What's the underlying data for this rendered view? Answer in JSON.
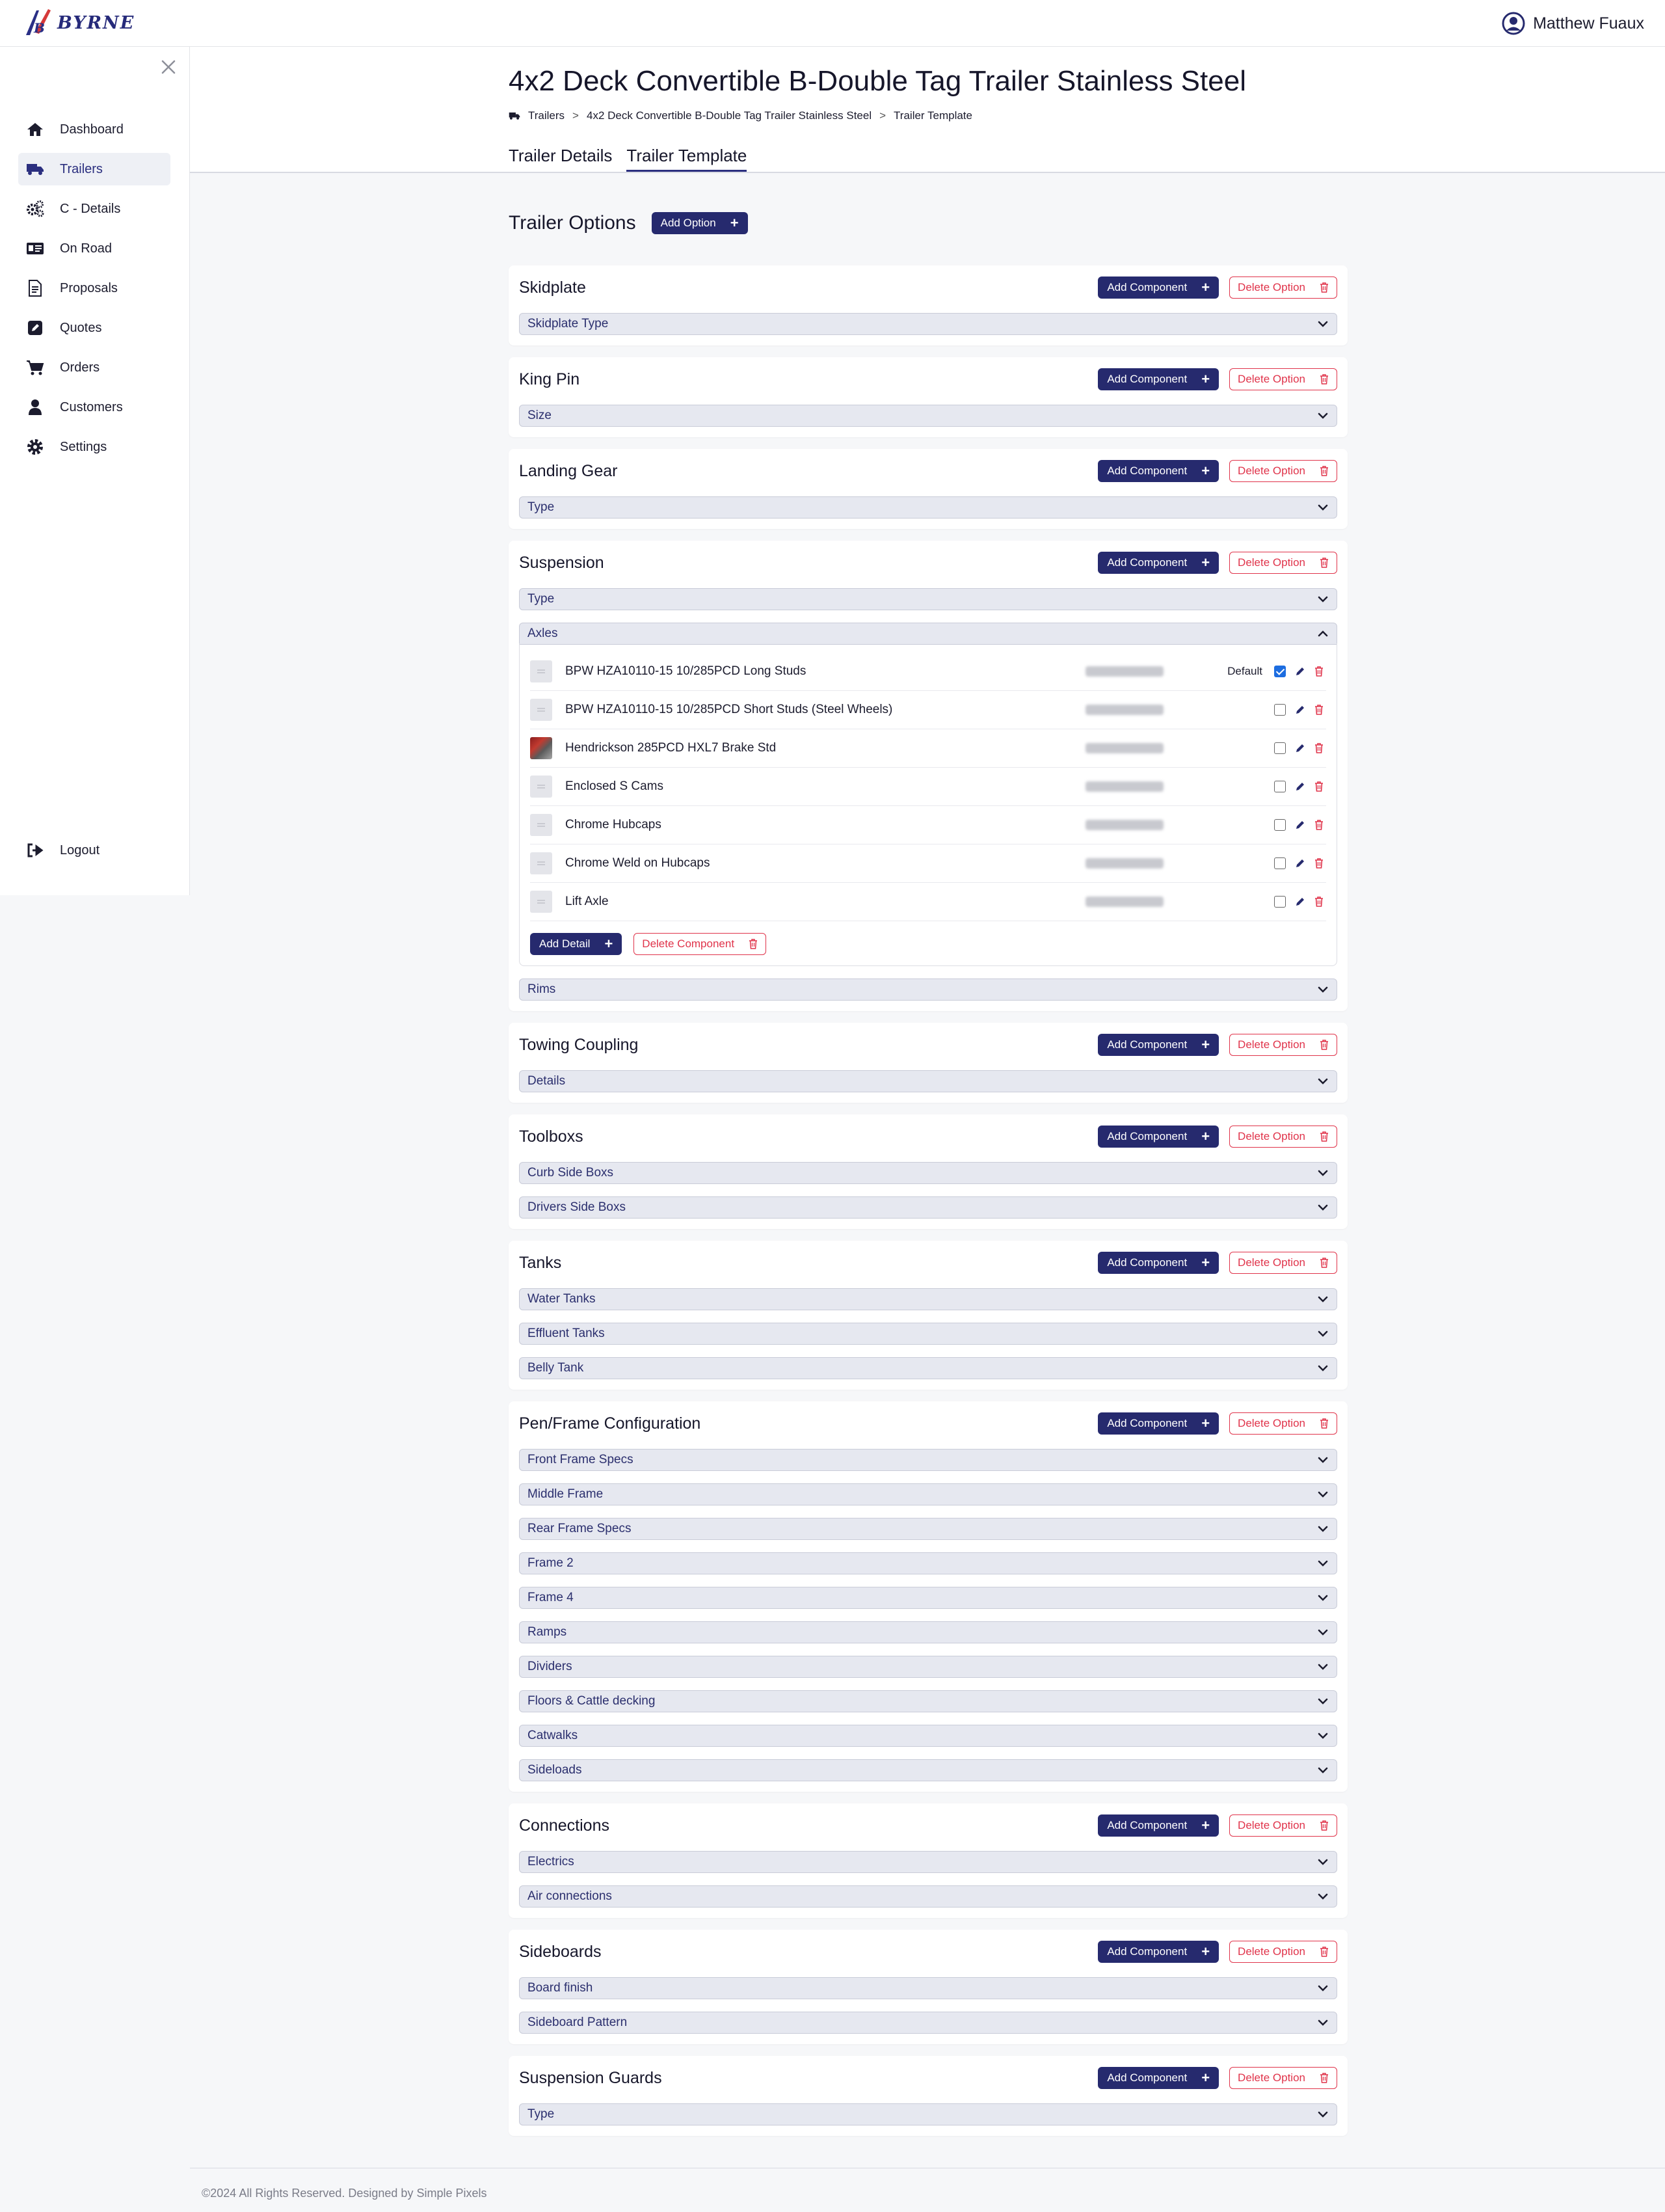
{
  "brand": {
    "name": "BYRNE"
  },
  "user": {
    "name": "Matthew Fuaux"
  },
  "sidebar": {
    "items": [
      {
        "label": "Dashboard",
        "icon": "home-icon",
        "active": false
      },
      {
        "label": "Trailers",
        "icon": "truck-icon",
        "active": true
      },
      {
        "label": "C - Details",
        "icon": "gears-icon",
        "active": false
      },
      {
        "label": "On Road",
        "icon": "id-card-icon",
        "active": false
      },
      {
        "label": "Proposals",
        "icon": "document-icon",
        "active": false
      },
      {
        "label": "Quotes",
        "icon": "edit-icon",
        "active": false
      },
      {
        "label": "Orders",
        "icon": "cart-icon",
        "active": false
      },
      {
        "label": "Customers",
        "icon": "user-icon",
        "active": false
      },
      {
        "label": "Settings",
        "icon": "gear-icon",
        "active": false
      }
    ],
    "logout": "Logout"
  },
  "page": {
    "title": "4x2 Deck Convertible B-Double Tag Trailer Stainless Steel",
    "breadcrumb": [
      "Trailers",
      "4x2 Deck Convertible B-Double Tag Trailer Stainless Steel",
      "Trailer Template"
    ],
    "tabs": [
      {
        "label": "Trailer Details",
        "active": false
      },
      {
        "label": "Trailer Template",
        "active": true
      }
    ]
  },
  "options_section": {
    "title": "Trailer Options",
    "add_option_label": "Add Option"
  },
  "labels": {
    "add_component": "Add Component",
    "delete_option": "Delete Option",
    "add_detail": "Add Detail",
    "delete_component": "Delete Component",
    "default": "Default"
  },
  "options": [
    {
      "title": "Skidplate",
      "components": [
        {
          "label": "Skidplate Type"
        }
      ]
    },
    {
      "title": "King Pin",
      "components": [
        {
          "label": "Size"
        }
      ]
    },
    {
      "title": "Landing Gear",
      "components": [
        {
          "label": "Type"
        }
      ]
    },
    {
      "title": "Suspension",
      "components": [
        {
          "label": "Type"
        },
        {
          "label": "Axles",
          "expanded": true,
          "details": [
            {
              "name": "BPW HZA10110-15 10/285PCD Long Studs",
              "default": true,
              "thumb": "placeholder"
            },
            {
              "name": "BPW HZA10110-15 10/285PCD Short Studs (Steel Wheels)",
              "default": false,
              "thumb": "placeholder"
            },
            {
              "name": "Hendrickson 285PCD HXL7 Brake Std",
              "default": false,
              "thumb": "photo"
            },
            {
              "name": "Enclosed S Cams",
              "default": false,
              "thumb": "placeholder"
            },
            {
              "name": "Chrome Hubcaps",
              "default": false,
              "thumb": "placeholder"
            },
            {
              "name": "Chrome Weld on Hubcaps",
              "default": false,
              "thumb": "placeholder"
            },
            {
              "name": "Lift Axle",
              "default": false,
              "thumb": "placeholder"
            }
          ]
        },
        {
          "label": "Rims"
        }
      ]
    },
    {
      "title": "Towing Coupling",
      "components": [
        {
          "label": "Details"
        }
      ]
    },
    {
      "title": "Toolboxs",
      "components": [
        {
          "label": "Curb Side Boxs"
        },
        {
          "label": "Drivers Side Boxs"
        }
      ]
    },
    {
      "title": "Tanks",
      "components": [
        {
          "label": "Water Tanks"
        },
        {
          "label": "Effluent Tanks"
        },
        {
          "label": "Belly Tank"
        }
      ]
    },
    {
      "title": "Pen/Frame Configuration",
      "components": [
        {
          "label": "Front Frame Specs"
        },
        {
          "label": "Middle Frame"
        },
        {
          "label": "Rear Frame Specs"
        },
        {
          "label": "Frame 2"
        },
        {
          "label": "Frame 4"
        },
        {
          "label": "Ramps"
        },
        {
          "label": "Dividers"
        },
        {
          "label": "Floors & Cattle decking"
        },
        {
          "label": "Catwalks"
        },
        {
          "label": "Sideloads"
        }
      ]
    },
    {
      "title": "Connections",
      "components": [
        {
          "label": "Electrics"
        },
        {
          "label": "Air connections"
        }
      ]
    },
    {
      "title": "Sideboards",
      "components": [
        {
          "label": "Board finish"
        },
        {
          "label": "Sideboard Pattern"
        }
      ]
    },
    {
      "title": "Suspension Guards",
      "components": [
        {
          "label": "Type"
        }
      ]
    }
  ],
  "footer": {
    "text": "©2024 All Rights Reserved. Designed by Simple Pixels"
  },
  "colors": {
    "primary": "#262a6e",
    "danger": "#e0334a",
    "accent": "#1d6de0"
  }
}
